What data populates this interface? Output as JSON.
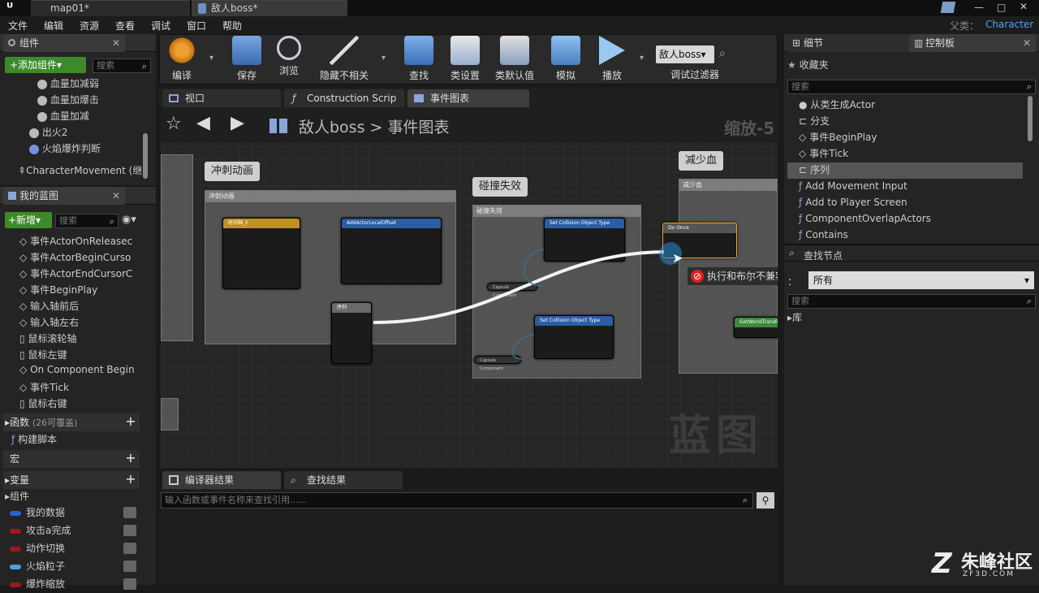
{
  "titlebar": {
    "logo": "ᵁ",
    "tabs": [
      "map01*",
      "敌人boss*"
    ],
    "parent_label": "父类：",
    "parent_value": "Character"
  },
  "menubar": [
    "文件",
    "编辑",
    "资源",
    "查看",
    "调试",
    "窗口",
    "帮助"
  ],
  "components_panel": {
    "title": "组件",
    "add_button": "+添加组件▾",
    "search_placeholder": "搜索",
    "items": [
      "血量加减弱",
      "血量加爆击",
      "血量加减",
      "出火2",
      "火焰爆炸判断",
      "CharacterMovement (继"
    ]
  },
  "blueprint_panel": {
    "title": "我的蓝图",
    "new_button": "+新增▾",
    "search_placeholder": "搜索",
    "events": [
      "事件ActorOnReleasec",
      "事件ActorBeginCurso",
      "事件ActorEndCursorC",
      "事件BeginPlay",
      "输入轴前后",
      "输入轴左右",
      "鼠标滚轮轴",
      "鼠标左键",
      "On Component Begin",
      "事件Tick",
      "鼠标右键"
    ],
    "functions_label": "函数",
    "functions_note": "(26可覆盖)",
    "construction": "构建脚本",
    "macros_label": "宏",
    "variables_label": "变量",
    "variables_group": "组件",
    "variables": [
      {
        "name": "我的数据",
        "color": "#2a5fd6"
      },
      {
        "name": "攻击a完成",
        "color": "#9a1a1a"
      },
      {
        "name": "动作切换",
        "color": "#9a1a1a"
      },
      {
        "name": "火焰粒子",
        "color": "#4aa0e0"
      },
      {
        "name": "爆炸缩放",
        "color": "#9a1a1a"
      }
    ]
  },
  "toolbar": {
    "buttons": [
      "编译",
      "保存",
      "浏览",
      "隐藏不相关",
      "查找",
      "类设置",
      "类默认值",
      "模拟",
      "播放"
    ],
    "debug_select": "敌人boss▾",
    "debug_label": "调试过滤器"
  },
  "editor_tabs": [
    "视口",
    "Construction Scrip",
    "事件图表"
  ],
  "graph": {
    "breadcrumb_root": "敌人boss",
    "breadcrumb_sep": ">",
    "breadcrumb_leaf": "事件图表",
    "zoom": "缩放-5",
    "comments": [
      {
        "bubble": "冲刺动画",
        "header": "冲刺动画"
      },
      {
        "bubble": "碰撞失效",
        "header": "碰撞失效"
      },
      {
        "bubble": "减少血",
        "header": "减少血"
      }
    ],
    "nodes": {
      "timeline": "时间轴_0",
      "add_offset": "AddActorLocalOffset",
      "sequence": "序列",
      "set_collision_1": "Set Collision Object Type",
      "set_collision_2": "Set Collision Object Type",
      "do_once": "Do Once",
      "capsule_1": "Capsule Component",
      "capsule_2": "Capsule Component",
      "get_world": "GetWorldTransform"
    },
    "error_tooltip": "执行和布尔不兼容。",
    "watermark": "蓝图"
  },
  "bottom_panel": {
    "tabs": [
      "编译器结果",
      "查找结果"
    ],
    "search_placeholder": "输入函数或事件名称来查找引用......"
  },
  "details_panel": {
    "tab_details": "细节",
    "tab_palette": "控制板",
    "favorites": "收藏夹",
    "search_placeholder": "搜索",
    "items": [
      "从类生成Actor",
      "分支",
      "事件BeginPlay",
      "事件Tick",
      "序列",
      "Add Movement Input",
      "Add to Player Screen",
      "ComponentOverlapActors",
      "Contains"
    ],
    "find_node_title": "查找节点",
    "filter_label": "：",
    "filter_value": "所有",
    "library": "库"
  },
  "site_watermark": {
    "main": "朱峰社区",
    "sub": "ZF3D.COM"
  }
}
